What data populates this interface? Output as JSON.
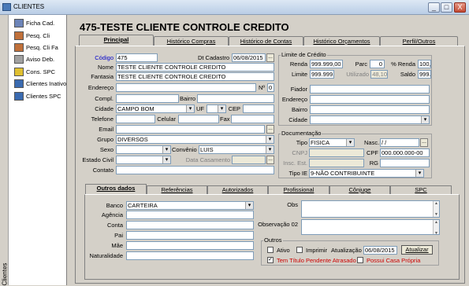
{
  "window": {
    "title": "CLIENTES",
    "minimize": "_",
    "maximize": "□",
    "close": "X"
  },
  "sidebar": {
    "vertical_label": "Clientes",
    "items": [
      {
        "label": "Ficha Cad.",
        "icon": "folder-icon",
        "color": "#6c84b8"
      },
      {
        "label": "Pesq. Cli",
        "icon": "search-people-icon",
        "color": "#c0703a"
      },
      {
        "label": "Pesq. Cli Fa",
        "icon": "search-people-icon",
        "color": "#c0703a"
      },
      {
        "label": "Aviso Deb.",
        "icon": "notice-icon",
        "color": "#a0a0a0"
      },
      {
        "label": "Cons. SPC",
        "icon": "spc-icon",
        "color": "#e0c030"
      },
      {
        "label": "Clientes Inativo",
        "icon": "list-icon",
        "color": "#3a6ab0"
      },
      {
        "label": "Clientes SPC",
        "icon": "list-icon",
        "color": "#3a6ab0"
      }
    ]
  },
  "page_title": "475-TESTE CLIENTE CONTROLE CREDITO",
  "tabs": [
    "Principal",
    "Histórico Compras",
    "Histórico de Contas",
    "Histórico Orçamentos",
    "Perfil/Outros"
  ],
  "form": {
    "codigo_label": "Código",
    "codigo": "475",
    "dtcad_label": "Dt Cadastro",
    "dtcad": "06/08/2015",
    "nome_label": "Nome",
    "nome": "TESTE CLIENTE CONTROLE CREDITO",
    "fantasia_label": "Fantasia",
    "fantasia": "TESTE CLIENTE CONTROLE CREDITO",
    "endereco_label": "Endereço",
    "endereco": "",
    "numero_label": "Nº",
    "numero": "0",
    "compl_label": "Compl.",
    "compl": "",
    "bairro_label": "Bairro",
    "bairro": "",
    "cidade_label": "Cidade",
    "cidade": "CAMPO BOM",
    "uf_label": "UF",
    "uf": "",
    "cep_label": "CEP",
    "cep": "",
    "telefone_label": "Telefone",
    "telefone": "",
    "celular_label": "Celular",
    "celular": "",
    "fax_label": "Fax",
    "fax": "",
    "email_label": "Email",
    "email": "",
    "grupo_label": "Grupo",
    "grupo": "DIVERSOS",
    "sexo_label": "Sexo",
    "sexo": "",
    "convenio_label": "Convênio",
    "convenio": "LUIS",
    "estcivil_label": "Estado Civil",
    "estcivil": "",
    "dtcasamento_label": "Data Casamento",
    "dtcasamento": "",
    "contato_label": "Contato",
    "contato": ""
  },
  "credito": {
    "title": "Limite de Crédito",
    "renda_label": "Renda",
    "renda": "999.999,00",
    "parc_label": "Parc",
    "parc": "0",
    "prenda_label": "% Renda",
    "prenda": "100,00",
    "limite_label": "Limite",
    "limite": "999.999,",
    "utilizado_label": "Utilizado",
    "utilizado": "48,10",
    "saldo_label": "Saldo",
    "saldo": "999.950,",
    "fiador_label": "Fiador",
    "endereco_label": "Endereço",
    "bairro_label": "Bairro",
    "cidade_label": "Cidade"
  },
  "documentacao": {
    "title": "Documentação",
    "tipo_label": "Tipo",
    "tipo": "FISICA",
    "nasc_label": "Nasc.",
    "nasc": "/ /",
    "cnpj_label": "CNPJ",
    "cpf_label": "CPF",
    "cpf": "000.000.000-00",
    "inscest_label": "Insc. Est.",
    "rg_label": "RG",
    "tipoie_label": "Tipo IE",
    "tipoie": "9-NÃO CONTRIBUINTE"
  },
  "bottom_tabs": [
    "Outros dados",
    "Referências",
    "Autorizados",
    "Profissional",
    "Cônjuge",
    "SPC"
  ],
  "outros": {
    "banco_label": "Banco",
    "banco": "CARTEIRA",
    "agencia_label": "Agência",
    "conta_label": "Conta",
    "pai_label": "Pai",
    "mae_label": "Mãe",
    "naturalidade_label": "Naturalidade",
    "obs_label": "Obs",
    "obs2_label": "Observação 02",
    "group_title": "Outros",
    "ativo_label": "Ativo",
    "imprimir_label": "Imprimir",
    "atualizacao_label": "Atualização",
    "atualizacao": "06/08/2015",
    "atualizar_label": "Atualizar",
    "pendente_label": "Tem Título Pendente Atrasado",
    "casapropria_label": "Possui Casa Própria",
    "warn_color": "#cc0000"
  }
}
